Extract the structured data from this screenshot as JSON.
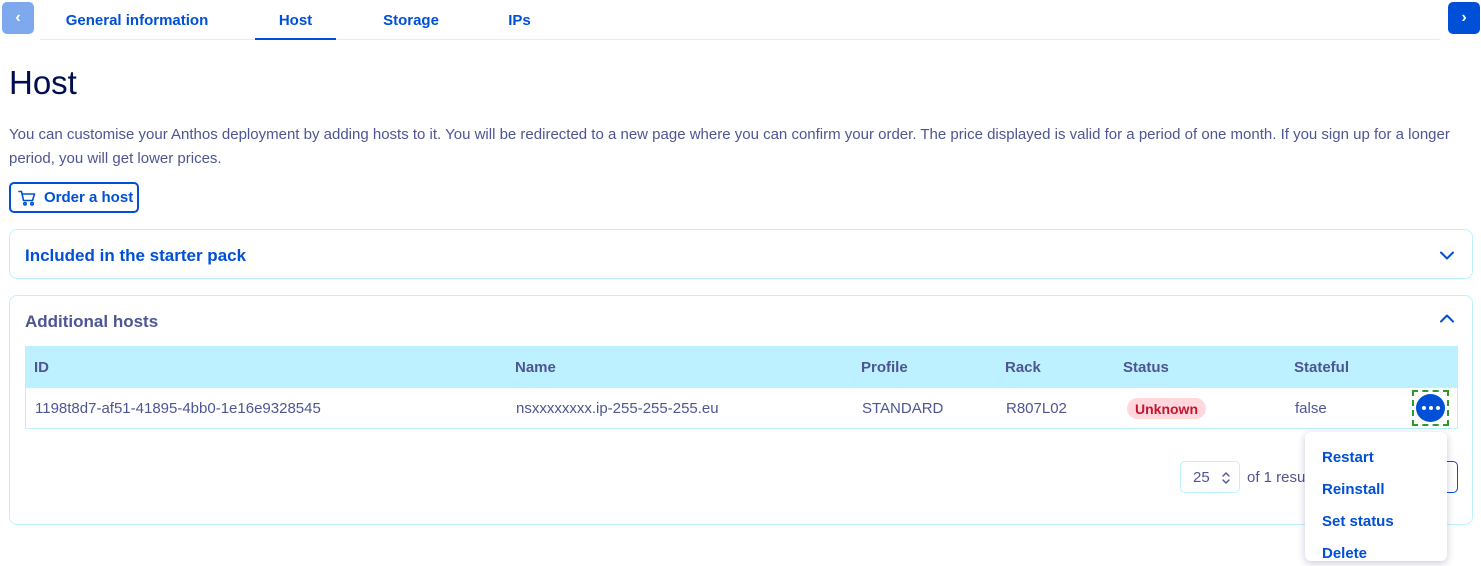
{
  "tabs": {
    "items": [
      {
        "label": "General information"
      },
      {
        "label": "Host"
      },
      {
        "label": "Storage"
      },
      {
        "label": "IPs"
      }
    ],
    "active_index": 1
  },
  "page": {
    "title": "Host",
    "description": "You can customise your Anthos deployment by adding hosts to it. You will be redirected to a new page where you can confirm your order. The price displayed is valid for a period of one month. If you sign up for a longer period, you will get lower prices.",
    "order_button_label": "Order a host"
  },
  "starter_pack": {
    "title": "Included in the starter pack",
    "expanded": false
  },
  "additional_hosts": {
    "title": "Additional hosts",
    "expanded": true,
    "columns": [
      "ID",
      "Name",
      "Profile",
      "Rack",
      "Status",
      "Stateful"
    ],
    "rows": [
      {
        "id": "1198t8d7-af51-41895-4bb0-1e16e9328545",
        "name": "nsxxxxxxxx.ip-255-255-255.eu",
        "profile": "STANDARD",
        "rack": "R807L02",
        "status": "Unknown",
        "stateful": "false"
      }
    ],
    "pagination": {
      "page_size": "25",
      "results_text": "of 1 resul"
    }
  },
  "actions_menu": {
    "items": [
      {
        "label": "Restart"
      },
      {
        "label": "Reinstall"
      },
      {
        "label": "Set status"
      },
      {
        "label": "Delete"
      }
    ]
  },
  "colors": {
    "primary": "#0050d7",
    "heading": "#000d51",
    "text": "#4d5693",
    "table_header": "#bef1ff",
    "status_unknown_bg": "#ffd7dd",
    "status_unknown_text": "#c5152d",
    "focus_outline": "#2e9a28"
  },
  "icons": {
    "prev": "chevron-left-icon",
    "next": "chevron-right-icon",
    "cart": "cart-icon",
    "collapse": "chevron-up-icon",
    "expand": "chevron-down-icon",
    "actions": "more-horizontal-icon",
    "sort": "sort-updown-icon"
  }
}
